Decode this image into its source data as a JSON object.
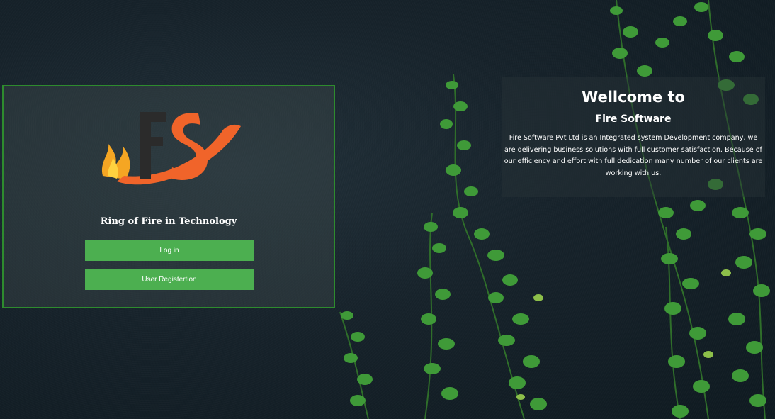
{
  "login_panel": {
    "logo_text": "FS",
    "tagline": "Ring of Fire in Technology",
    "login_button": "Log in",
    "register_button": "User Registertion"
  },
  "welcome": {
    "title": "Wellcome to",
    "subtitle": "Fire Software",
    "description": "Fire Software Pvt Ltd is an Integrated system Development company, we are delivering business solutions with full customer satisfaction. Because of our efficiency and effort with full dedication many number of our clients are working with us."
  },
  "colors": {
    "accent_green": "#4caf50",
    "panel_border": "#2e8b2e",
    "logo_orange": "#f0642a",
    "logo_dark": "#2b2b2b"
  },
  "icons": [
    "fs-logo",
    "flame-icon",
    "ivy-vines"
  ]
}
